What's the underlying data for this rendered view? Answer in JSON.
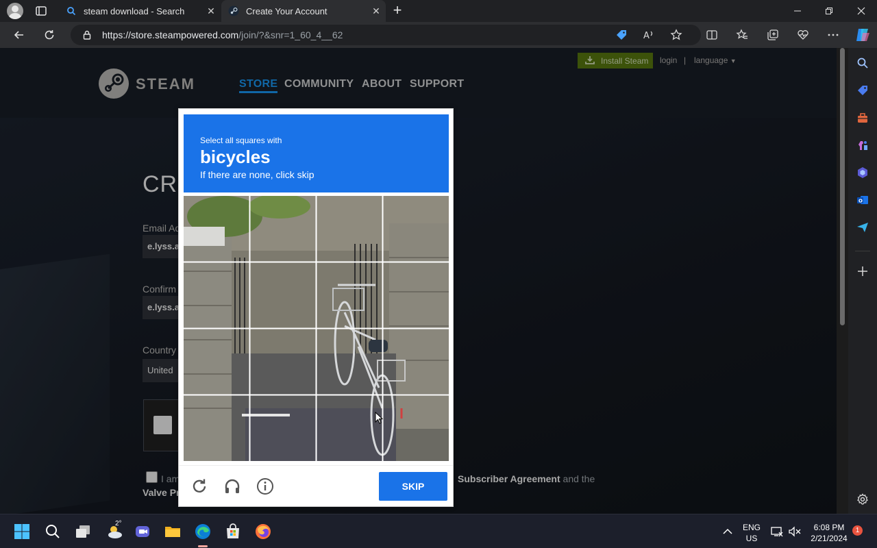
{
  "browser": {
    "tabs": [
      {
        "title": "steam download - Search",
        "icon": "search-icon"
      },
      {
        "title": "Create Your Account",
        "icon": "steam-favicon",
        "active": true
      }
    ],
    "new_tab_label": "+",
    "url_host": "https://store.steampowered.com",
    "url_path": "/join/?&snr=1_60_4__62"
  },
  "steam": {
    "install_label": "Install Steam",
    "login_label": "login",
    "separator": "|",
    "language_label": "language",
    "logo_text": "STEAM",
    "nav": [
      "STORE",
      "COMMUNITY",
      "ABOUT",
      "SUPPORT"
    ],
    "page_title": "CRE",
    "email_label": "Email Ad",
    "email_value": "e.lyss.a",
    "confirm_label": "Confirm",
    "confirm_value": "e.lyss.a",
    "country_label": "Country",
    "country_value": "United",
    "agree_prefix": "I am",
    "agree_link": "Subscriber Agreement",
    "agree_suffix": "and the",
    "agree_line2": "Valve Pri"
  },
  "captcha": {
    "prompt_line1": "Select all squares with",
    "prompt_word": "bicycles",
    "prompt_line3": "If there are none, click skip",
    "skip_label": "SKIP",
    "accent": "#1a73e8"
  },
  "taskbar": {
    "weather": "2°",
    "lang_top": "ENG",
    "lang_bottom": "US",
    "time": "6:08 PM",
    "date": "2/21/2024",
    "notif_count": "1"
  }
}
